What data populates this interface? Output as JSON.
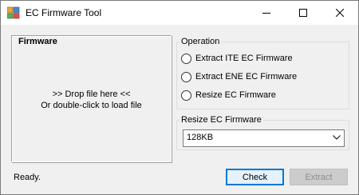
{
  "window": {
    "title": "EC Firmware Tool",
    "app_icon": "app-icon",
    "controls": [
      "minimize-icon",
      "maximize-icon",
      "close-icon"
    ]
  },
  "firmware_panel": {
    "title": "Firmware",
    "hint_line1": ">> Drop file here <<",
    "hint_line2": "Or double-click to load file"
  },
  "operation": {
    "label": "Operation",
    "options": [
      {
        "label": "Extract ITE EC Firmware",
        "selected": false
      },
      {
        "label": "Extract ENE EC Firmware",
        "selected": false
      },
      {
        "label": "Resize EC Firmware",
        "selected": false
      }
    ]
  },
  "resize": {
    "label": "Resize EC Firmware",
    "selected_value": "128KB"
  },
  "status": "Ready.",
  "buttons": {
    "check": "Check",
    "extract": "Extract",
    "extract_enabled": false
  },
  "colors": {
    "window_bg": "#f0f0f0",
    "focus_border": "#0078d7",
    "disabled_button": "#cccccc"
  }
}
